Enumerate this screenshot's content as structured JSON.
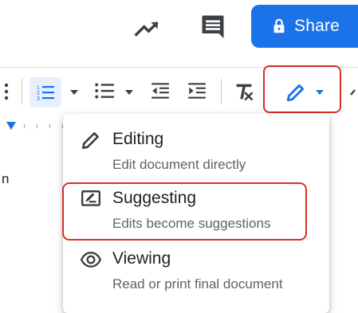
{
  "header": {
    "share_label": "Share",
    "accent_color": "#1a73e8",
    "icons": [
      "activity-trend-icon",
      "comment-icon",
      "lock-icon"
    ]
  },
  "toolbar": {
    "icons": [
      "more-vert-icon",
      "numbered-list-icon",
      "dropdown-arrow-icon",
      "bulleted-list-icon",
      "dropdown-arrow-icon",
      "decrease-indent-icon",
      "increase-indent-icon",
      "clear-formatting-icon",
      "pencil-icon",
      "dropdown-arrow-icon"
    ],
    "active_item": "numbered-list",
    "highlight_color": "#d93025"
  },
  "document": {
    "visible_text": "n"
  },
  "mode_menu": {
    "items": [
      {
        "name": "editing",
        "icon": "pencil-icon",
        "title": "Editing",
        "subtitle": "Edit document directly"
      },
      {
        "name": "suggesting",
        "icon": "suggest-edit-icon",
        "title": "Suggesting",
        "subtitle": "Edits become suggestions"
      },
      {
        "name": "viewing",
        "icon": "eye-icon",
        "title": "Viewing",
        "subtitle": "Read or print final document"
      }
    ],
    "highlighted_item": "suggesting"
  }
}
